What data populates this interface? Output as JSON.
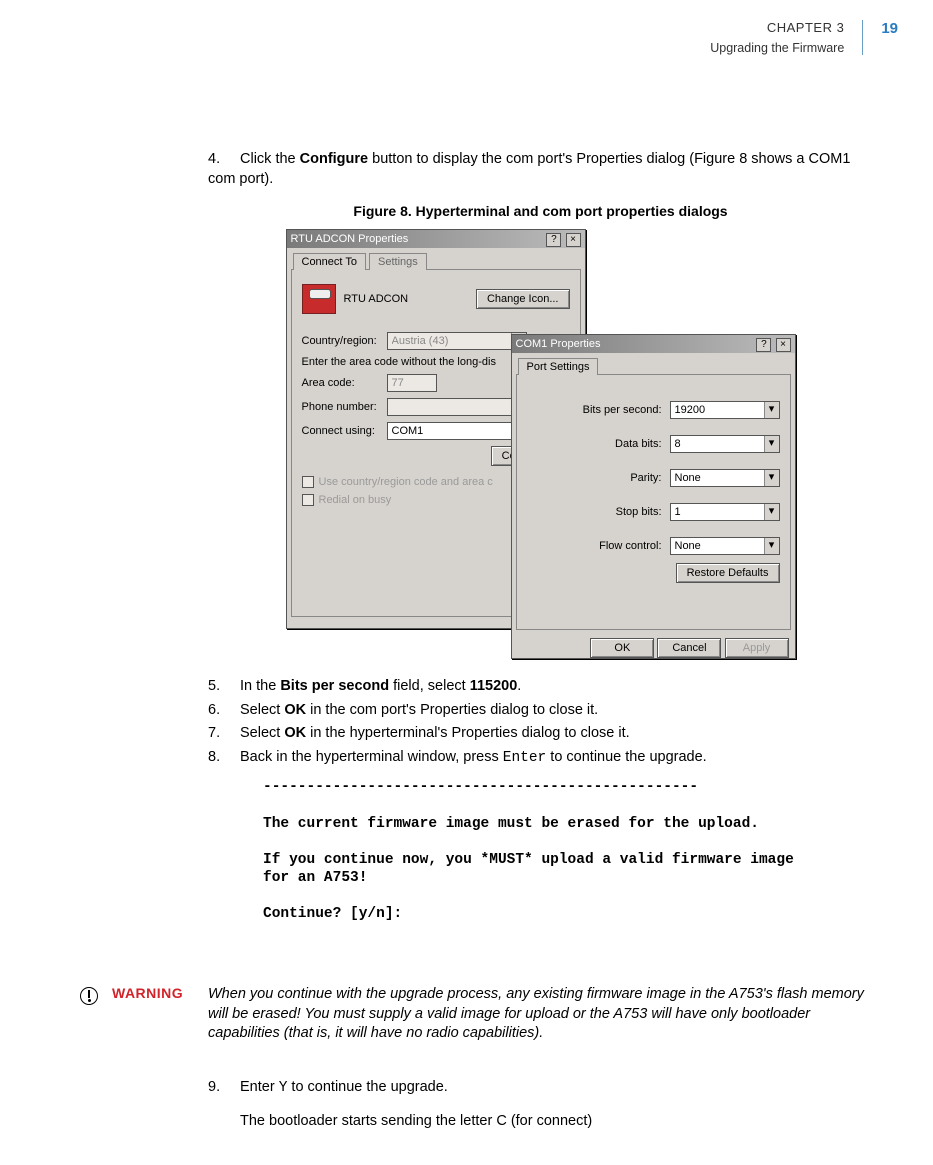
{
  "header": {
    "chapter": "CHAPTER 3",
    "subtitle": "Upgrading the Firmware",
    "page": "19"
  },
  "step4": {
    "num": "4.",
    "text_a": "Click the ",
    "bold_a": "Configure",
    "text_b": " button to display the com port's Properties dialog (Figure 8 shows a COM1 com port)."
  },
  "figure_caption": "Figure 8.  Hyperterminal and com port properties dialogs",
  "dlg1": {
    "title": "RTU ADCON Properties",
    "tab1": "Connect To",
    "tab2": "Settings",
    "name": "RTU ADCON",
    "change_icon": "Change Icon...",
    "country_lbl": "Country/region:",
    "country_val": "Austria (43)",
    "area_hint": "Enter the area code without the long-dis",
    "area_lbl": "Area code:",
    "area_val": "77",
    "phone_lbl": "Phone number:",
    "connect_lbl": "Connect using:",
    "connect_val": "COM1",
    "configure": "Configure...",
    "chk1": "Use country/region code and area c",
    "chk2": "Redial on busy"
  },
  "dlg2": {
    "title": "COM1 Properties",
    "tab": "Port Settings",
    "bits_lbl": "Bits per second:",
    "bits_val": "19200",
    "databits_lbl": "Data bits:",
    "databits_val": "8",
    "parity_lbl": "Parity:",
    "parity_val": "None",
    "stopbits_lbl": "Stop bits:",
    "stopbits_val": "1",
    "flow_lbl": "Flow control:",
    "flow_val": "None",
    "restore": "Restore Defaults",
    "ok": "OK",
    "cancel": "Cancel",
    "apply": "Apply"
  },
  "step5": {
    "num": "5.",
    "a": "In the ",
    "b": "Bits per second",
    "c": " field, select ",
    "d": "115200",
    "e": "."
  },
  "step6": {
    "num": "6.",
    "a": "Select ",
    "b": "OK",
    "c": " in the com port's Properties dialog to close it."
  },
  "step7": {
    "num": "7.",
    "a": "Select ",
    "b": "OK",
    "c": " in the hyperterminal's Properties dialog to close it."
  },
  "step8": {
    "num": "8.",
    "a": "Back in the hyperterminal window, press ",
    "code": "Enter",
    "c": " to continue the upgrade."
  },
  "mono": {
    "dashes": "--------------------------------------------------",
    "line1": "The current firmware image must be erased for the upload.",
    "line2": "If you continue now, you *MUST* upload a valid firmware image for an A753!",
    "line3": "Continue? [y/n]:"
  },
  "warning": {
    "label": "WARNING",
    "text": "When you continue with the upgrade process, any existing firmware image in the A753's flash memory will be erased! You must supply a valid image for upload or the A753 will have only bootloader capabilities (that is, it will have no radio capabilities)."
  },
  "step9": {
    "num": "9.",
    "a": "Enter ",
    "code": "Y",
    "c": " to continue the upgrade."
  },
  "closing": "The bootloader starts sending the letter C (for connect)"
}
